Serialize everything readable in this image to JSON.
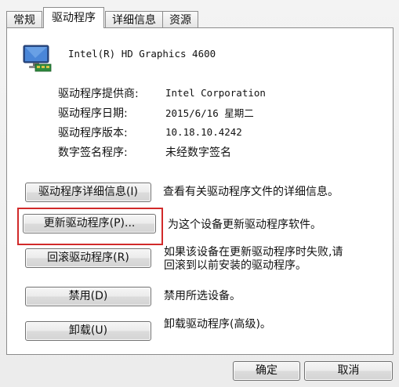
{
  "tabs": [
    {
      "label": "常规",
      "active": false
    },
    {
      "label": "驱动程序",
      "active": true
    },
    {
      "label": "详细信息",
      "active": false
    },
    {
      "label": "资源",
      "active": false
    }
  ],
  "device": {
    "icon": "display-adapter-icon",
    "name": "Intel(R) HD Graphics 4600"
  },
  "properties": [
    {
      "label": "驱动程序提供商:",
      "value": "Intel Corporation"
    },
    {
      "label": "驱动程序日期:",
      "value": "2015/6/16 星期二"
    },
    {
      "label": "驱动程序版本:",
      "value": "10.18.10.4242"
    },
    {
      "label": "数字签名程序:",
      "value": "未经数字签名"
    }
  ],
  "actions": [
    {
      "button": "驱动程序详细信息(I)",
      "description": "查看有关驱动程序文件的详细信息。"
    },
    {
      "button": "更新驱动程序(P)...",
      "description": "为这个设备更新驱动程序软件。"
    },
    {
      "button": "回滚驱动程序(R)",
      "description_lines": [
        "如果该设备在更新驱动程序时失败,请",
        "回滚到以前安装的驱动程序。"
      ]
    },
    {
      "button": "禁用(D)",
      "description": "禁用所选设备。"
    },
    {
      "button": "卸载(U)",
      "description": "卸载驱动程序(高级)。"
    }
  ],
  "footer": {
    "ok": "确定",
    "cancel": "取消"
  },
  "colors": {
    "highlight_border": "#d12a2a"
  }
}
